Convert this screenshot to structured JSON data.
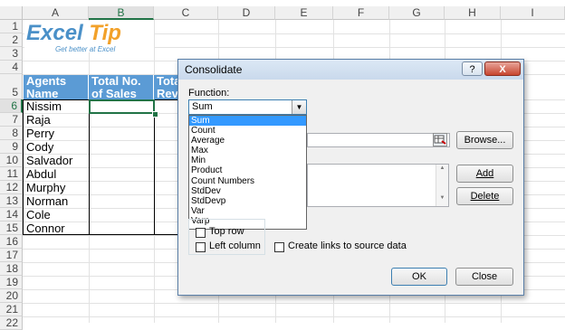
{
  "columns": [
    "A",
    "B",
    "C",
    "D",
    "E",
    "F",
    "G",
    "H",
    "I"
  ],
  "rows": [
    "1",
    "2",
    "3",
    "4",
    "5",
    "6",
    "7",
    "8",
    "9",
    "10",
    "11",
    "12",
    "13",
    "14",
    "15",
    "16",
    "17",
    "18",
    "19",
    "20",
    "21",
    "22"
  ],
  "logo": {
    "excel": "Excel",
    "tip": "Tip",
    "tagline": "Get better at Excel"
  },
  "table": {
    "headers": [
      "Agents Name",
      "Total No. of Sales",
      "Tota Reve"
    ],
    "agents": [
      "Nissim",
      "Raja",
      "Perry",
      "Cody",
      "Salvador",
      "Abdul",
      "Murphy",
      "Norman",
      "Cole",
      "Connor"
    ]
  },
  "dialog": {
    "title": "Consolidate",
    "help_btn": "?",
    "close_btn": "X",
    "function_label": "Function:",
    "function_value": "Sum",
    "function_options": [
      "Sum",
      "Count",
      "Average",
      "Max",
      "Min",
      "Product",
      "Count Numbers",
      "StdDev",
      "StdDevp",
      "Var",
      "Varp"
    ],
    "browse_label": "Browse...",
    "add_label": "Add",
    "delete_label": "Delete",
    "top_row_label": "Top row",
    "left_column_label": "Left column",
    "create_links_label": "Create links to source data",
    "ok_label": "OK",
    "close_label": "Close"
  },
  "colors": {
    "header_fill": "#5b9bd5",
    "excel_green": "#217346",
    "selection_blue": "#3399ff"
  }
}
